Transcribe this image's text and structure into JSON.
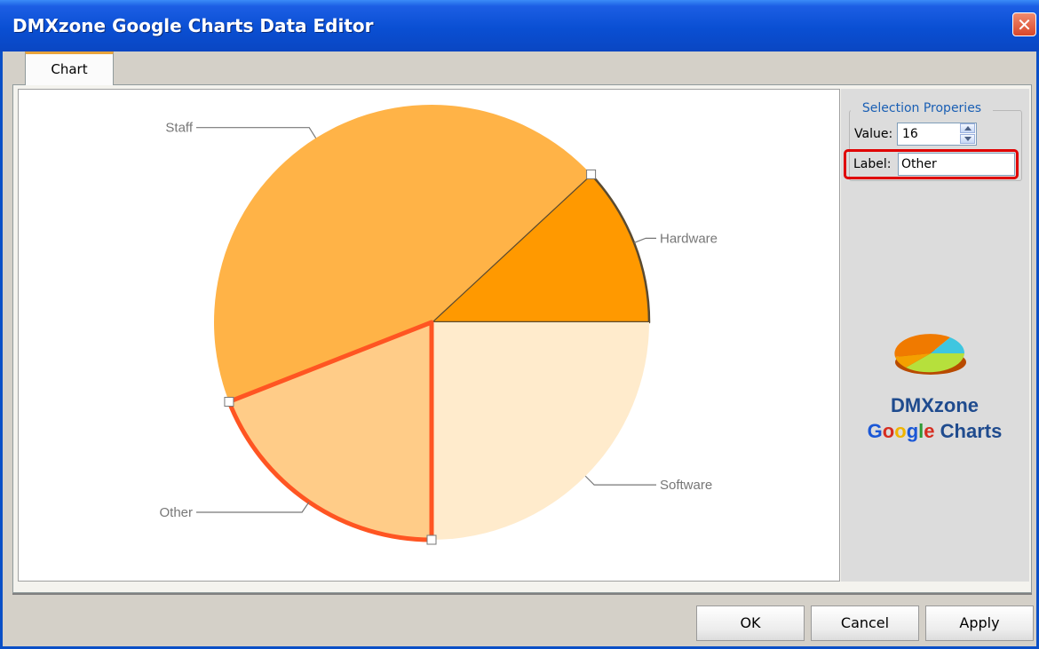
{
  "window": {
    "title": "DMXzone Google Charts Data Editor",
    "close_glyph": "✕"
  },
  "tabs": [
    {
      "label": "Chart"
    }
  ],
  "chart_data": {
    "type": "pie",
    "categories": [
      "Hardware",
      "Software",
      "Other",
      "Staff"
    ],
    "values": [
      10,
      21,
      16,
      37
    ],
    "selected": "Other",
    "colors": [
      "#ff9900",
      "#ffebcc",
      "#ffcc88",
      "#ffb347"
    ],
    "selected_outline_color": "#ff5522"
  },
  "selection_properties": {
    "title": "Selection Properies",
    "value_label": "Value:",
    "value": "16",
    "label_label": "Label:",
    "label_value": "Other"
  },
  "brand": {
    "line1": "DMXzone",
    "google_letters": [
      {
        "ch": "G",
        "color": "#1a57d6"
      },
      {
        "ch": "o",
        "color": "#d62d20"
      },
      {
        "ch": "o",
        "color": "#f0b400"
      },
      {
        "ch": "g",
        "color": "#1a57d6"
      },
      {
        "ch": "l",
        "color": "#2e9a35"
      },
      {
        "ch": "e",
        "color": "#d62d20"
      }
    ],
    "charts_word": "Charts",
    "charts_color": "#1f4b8e"
  },
  "buttons": {
    "ok": "OK",
    "cancel": "Cancel",
    "apply": "Apply"
  }
}
